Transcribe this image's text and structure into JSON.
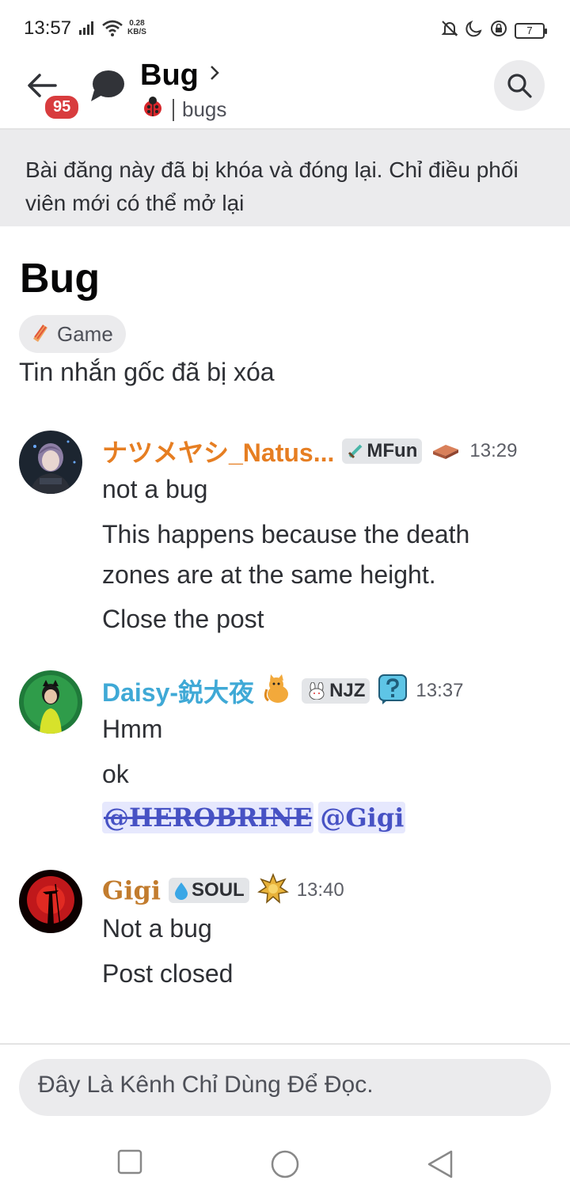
{
  "status_bar": {
    "time": "13:57",
    "net_speed_value": "0.28",
    "net_speed_unit": "KB/S",
    "battery": "7"
  },
  "header": {
    "title": "Bug",
    "channel": "bugs",
    "unread_badge": "95",
    "icons": [
      "back-arrow-icon",
      "thread-bubble-icon",
      "chevron-right-icon",
      "ladybug-icon",
      "search-icon"
    ]
  },
  "locked_banner": {
    "text": "Bài đăng này đã bị khóa và đóng lại. Chỉ điều phối viên mới có thể mở lại"
  },
  "post": {
    "title": "Bug",
    "tag": {
      "icon": "tag-emoji-icon",
      "label": "Game"
    },
    "original_deleted": "Tin nhắn gốc đã bị xóa"
  },
  "messages": [
    {
      "username": "ナツメヤシ_Natus...",
      "name_color": "#e67e22",
      "role_tag": "MFun",
      "time": "13:29",
      "lines": [
        "not a bug",
        "This happens because the death",
        "zones are at the same height.",
        "Close the post"
      ]
    },
    {
      "username": "Daisy-鋭大夜",
      "name_color": "#3fa9d6",
      "role_tag": "NJZ",
      "time": "13:37",
      "lines": [
        "Hmm",
        "ok"
      ],
      "mentions": [
        "@HEROBRINE",
        "@Gigi"
      ]
    },
    {
      "username": "Gigi",
      "name_color": "#c27c2e",
      "role_tag": "SOUL",
      "time": "13:40",
      "lines": [
        "Not a bug",
        "Post closed"
      ]
    }
  ],
  "composer": {
    "placeholder": "Đây Là Kênh Chỉ Dùng Để Đọc."
  },
  "colors": {
    "badge_red": "#d83c3e",
    "mention_bg": "#e6e8fd",
    "mention_fg": "#4752c4"
  }
}
